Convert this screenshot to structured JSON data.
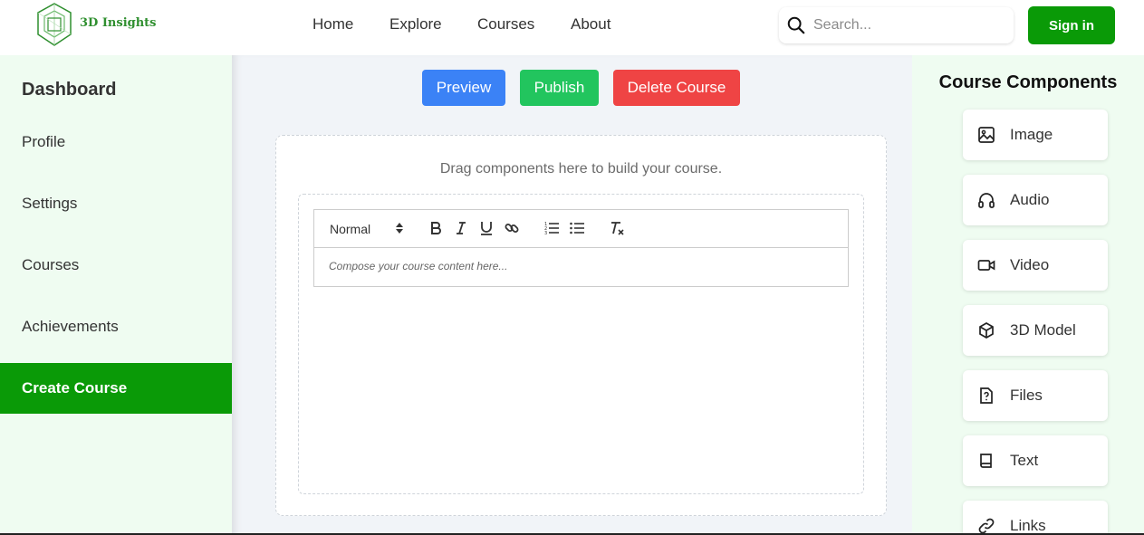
{
  "brand": {
    "name": "3D Insights"
  },
  "nav": {
    "home": "Home",
    "explore": "Explore",
    "courses": "Courses",
    "about": "About"
  },
  "search": {
    "placeholder": "Search..."
  },
  "auth": {
    "signin": "Sign in"
  },
  "sidebar": {
    "title": "Dashboard",
    "items": [
      {
        "label": "Profile"
      },
      {
        "label": "Settings"
      },
      {
        "label": "Courses"
      },
      {
        "label": "Achievements"
      },
      {
        "label": "Create Course",
        "active": true
      }
    ]
  },
  "actions": {
    "preview": "Preview",
    "publish": "Publish",
    "delete": "Delete Course"
  },
  "canvas": {
    "hint": "Drag components here to build your course."
  },
  "editor": {
    "format": "Normal",
    "tools": [
      "bold-icon",
      "italic-icon",
      "underline-icon",
      "link-icon",
      "ordered-list-icon",
      "bullet-list-icon",
      "clear-format-icon"
    ],
    "placeholder": "Compose your course content here..."
  },
  "components": {
    "title": "Course Components",
    "items": [
      {
        "label": "Image",
        "icon": "image-icon"
      },
      {
        "label": "Audio",
        "icon": "headphones-icon"
      },
      {
        "label": "Video",
        "icon": "video-camera-icon"
      },
      {
        "label": "3D Model",
        "icon": "cube-icon"
      },
      {
        "label": "Files",
        "icon": "file-question-icon"
      },
      {
        "label": "Text",
        "icon": "book-icon"
      },
      {
        "label": "Links",
        "icon": "link-icon"
      }
    ]
  },
  "colors": {
    "primary_green": "#0a9a07",
    "preview_blue": "#3b82f6",
    "publish_green": "#22c55e",
    "delete_red": "#ef4444",
    "panel_bg": "#effcf1"
  }
}
